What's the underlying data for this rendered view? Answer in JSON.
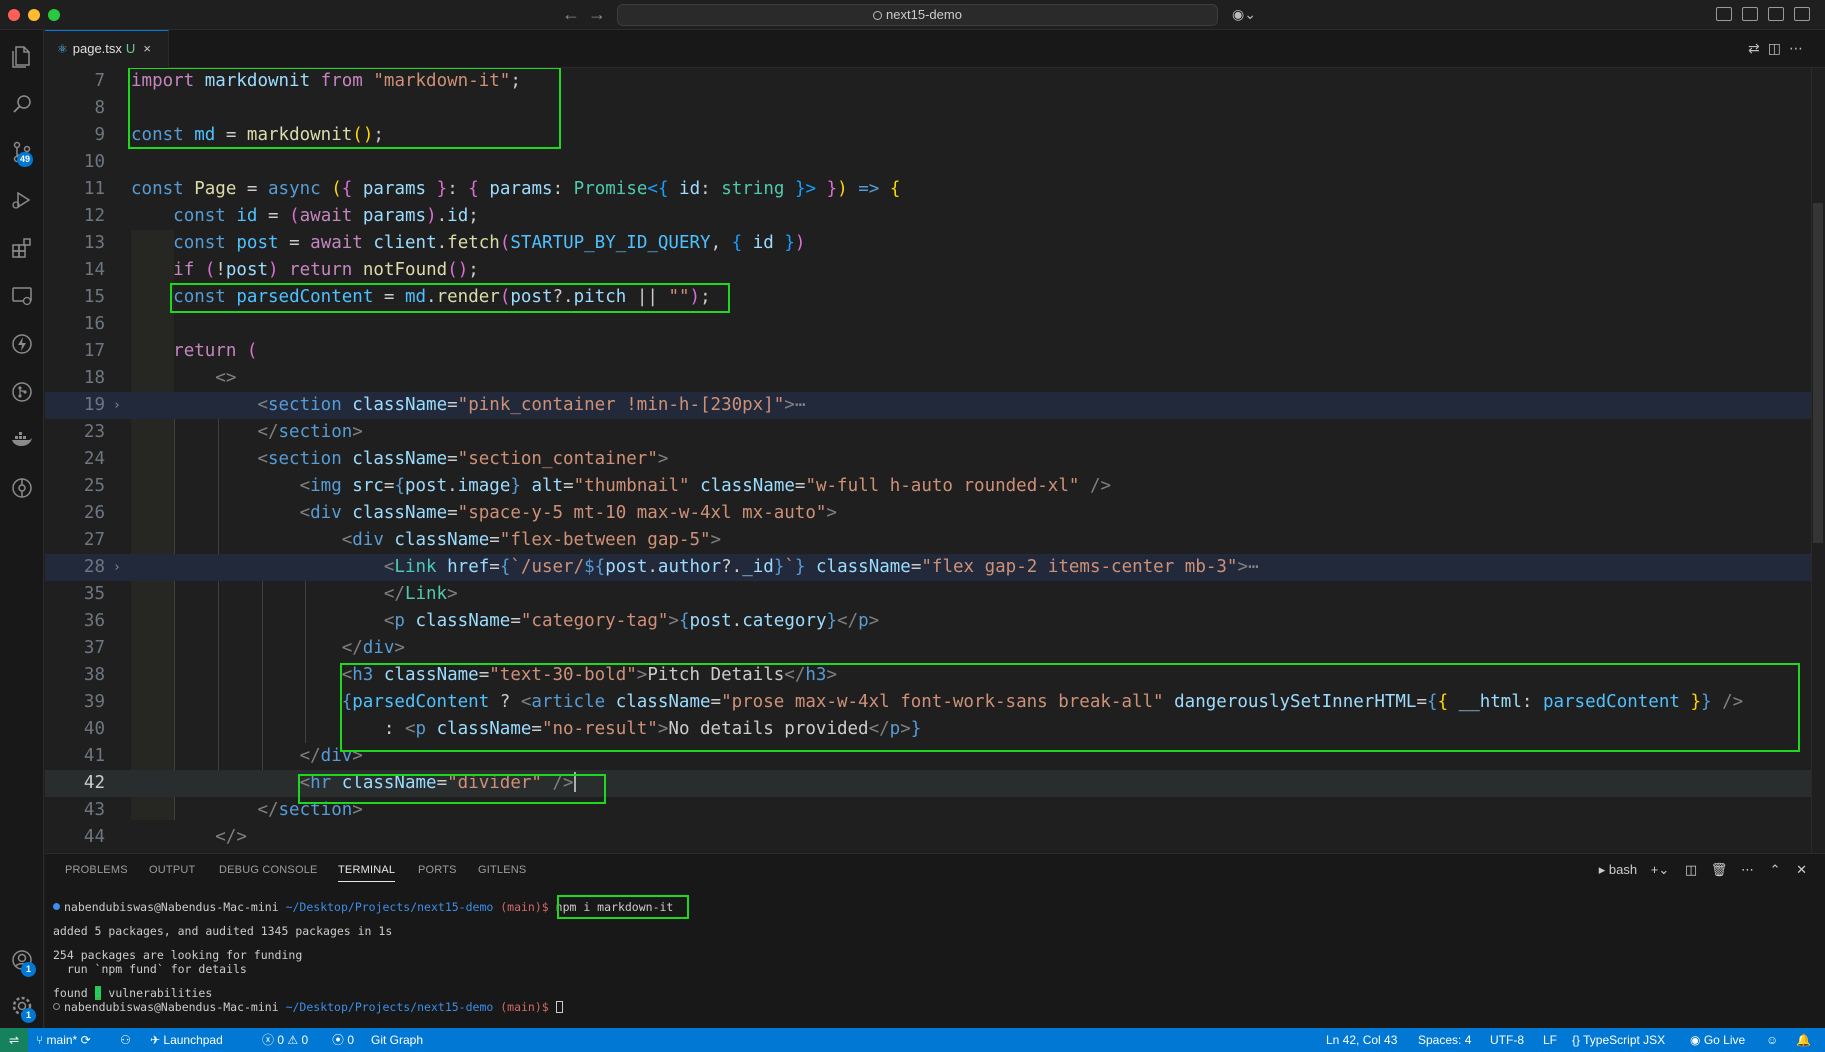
{
  "titlebar": {
    "command_center": "next15-demo",
    "back_icon": "arrow-left-icon",
    "forward_icon": "arrow-right-icon"
  },
  "activitybar": {
    "source_control_badge": "49",
    "accounts_badge": "1",
    "manage_badge": "1"
  },
  "tab": {
    "filename": "page.tsx",
    "status": "U",
    "close": "×"
  },
  "editor": {
    "active_line": "42",
    "lines": [
      {
        "n": "7"
      },
      {
        "n": "8"
      },
      {
        "n": "9"
      },
      {
        "n": "10"
      },
      {
        "n": "11"
      },
      {
        "n": "12"
      },
      {
        "n": "13"
      },
      {
        "n": "14"
      },
      {
        "n": "15"
      },
      {
        "n": "16"
      },
      {
        "n": "17"
      },
      {
        "n": "18"
      },
      {
        "n": "19"
      },
      {
        "n": "23"
      },
      {
        "n": "24"
      },
      {
        "n": "25"
      },
      {
        "n": "26"
      },
      {
        "n": "27"
      },
      {
        "n": "28"
      },
      {
        "n": "35"
      },
      {
        "n": "36"
      },
      {
        "n": "37"
      },
      {
        "n": "38"
      },
      {
        "n": "39"
      },
      {
        "n": "40"
      },
      {
        "n": "41"
      },
      {
        "n": "42"
      },
      {
        "n": "43"
      },
      {
        "n": "44"
      }
    ]
  },
  "panel": {
    "tabs": [
      "PROBLEMS",
      "OUTPUT",
      "DEBUG CONSOLE",
      "TERMINAL",
      "PORTS",
      "GITLENS"
    ],
    "active_tab": "TERMINAL",
    "shell": "bash",
    "terminal": {
      "prompt_user": "nabendubiswas@Nabendus-Mac-mini",
      "prompt_path": "~/Desktop/Projects/next15-demo",
      "prompt_branch": "(main)$",
      "command": "npm i markdown-it",
      "out1": "added 5 packages, and audited 1345 packages in 1s",
      "out2": "254 packages are looking for funding",
      "out3": "  run `npm fund` for details",
      "out4_prefix": "found ",
      "out4_count": "0",
      "out4_suffix": " vulnerabilities"
    }
  },
  "statusbar": {
    "branch": "main*",
    "launchpad": "Launchpad",
    "errors": "0",
    "warnings": "0",
    "ports": "0",
    "git_graph": "Git Graph",
    "position": "Ln 42, Col 43",
    "spaces": "Spaces: 4",
    "encoding": "UTF-8",
    "eol": "LF",
    "language": "TypeScript JSX",
    "go_live": "Go Live"
  },
  "colors": {
    "accent": "#0078d4",
    "highlight_box": "#1dd81d",
    "editor_bg": "#1f1f1f"
  }
}
